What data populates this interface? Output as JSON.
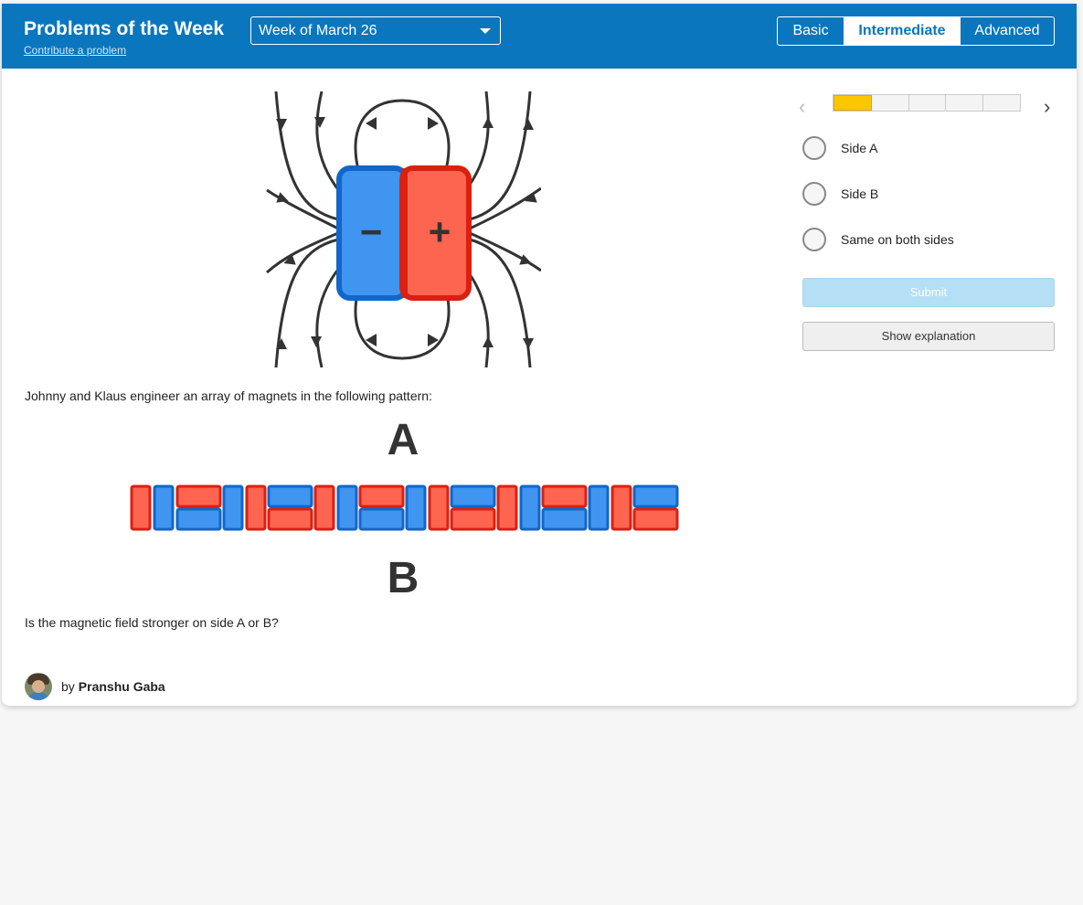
{
  "header": {
    "title": "Problems of the Week",
    "contribute_link": "Contribute a problem",
    "week_select": "Week of March 26",
    "levels": [
      "Basic",
      "Intermediate",
      "Advanced"
    ],
    "active_level": "Intermediate"
  },
  "colors": {
    "header_bg": "#0a76bd",
    "magnet_blue": "#3f95f0",
    "magnet_red": "#fe6550",
    "progress_fill": "#fcc600",
    "submit_disabled": "#b5dff5"
  },
  "figure": {
    "magnet_minus": "−",
    "magnet_plus": "+",
    "side_a_label": "A",
    "side_b_label": "B"
  },
  "problem": {
    "text": "Johnny and Klaus engineer an array of magnets in the following pattern:",
    "question": "Is the magnetic field stronger on side A or B?"
  },
  "author": {
    "prefix": "by",
    "name": "Pranshu Gaba"
  },
  "progress": {
    "total_steps": 5,
    "current_step": 1
  },
  "answers": {
    "options": [
      "Side A",
      "Side B",
      "Same on both sides"
    ]
  },
  "buttons": {
    "submit": "Submit",
    "explanation": "Show explanation"
  }
}
